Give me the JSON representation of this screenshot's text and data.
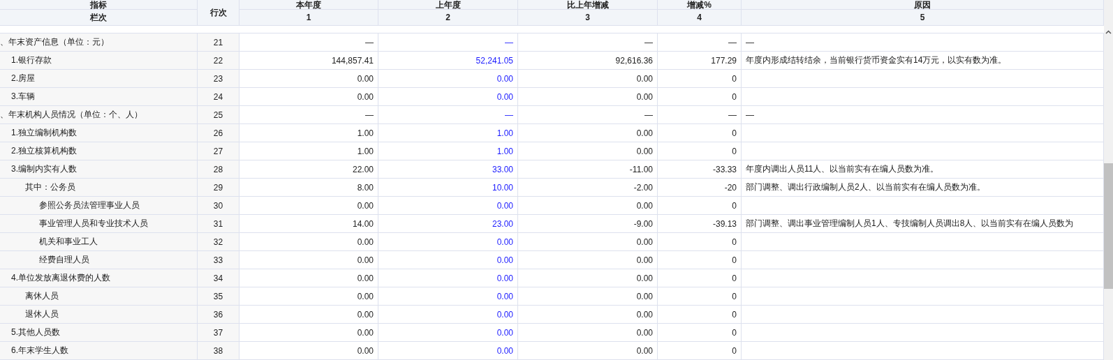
{
  "table": {
    "header_top": [
      "指标",
      "行次",
      "本年度",
      "上年度",
      "比上年增减",
      "增减%",
      "原因"
    ],
    "header_sub": [
      "栏次",
      "1",
      "2",
      "3",
      "4",
      "5"
    ],
    "rows": [
      {
        "label": "、年末资产信息（单位：元）",
        "line": "21",
        "values": [
          "—",
          "—",
          "—",
          "—"
        ],
        "reason": "—",
        "children": [
          {
            "label": "1.银行存款",
            "line": "22",
            "values": [
              "144,857.41",
              "52,241.05",
              "92,616.36",
              "177.29"
            ],
            "reason": "年度内形成结转结余，当前银行货币资金实有14万元，以实有数为准。"
          },
          {
            "label": "2.房屋",
            "line": "23",
            "values": [
              "0.00",
              "0.00",
              "0.00",
              "0"
            ]
          },
          {
            "label": "3.车辆",
            "line": "24",
            "values": [
              "0.00",
              "0.00",
              "0.00",
              "0"
            ]
          }
        ]
      },
      {
        "label": "、年末机构人员情况（单位：个、人）",
        "line": "25",
        "values": [
          "—",
          "—",
          "—",
          "—"
        ],
        "reason": "—",
        "children": [
          {
            "label": "1.独立编制机构数",
            "line": "26",
            "values": [
              "1.00",
              "1.00",
              "0.00",
              "0"
            ]
          },
          {
            "label": "2.独立核算机构数",
            "line": "27",
            "values": [
              "1.00",
              "1.00",
              "0.00",
              "0"
            ]
          },
          {
            "label": "3.编制内实有人数",
            "line": "28",
            "values": [
              "22.00",
              "33.00",
              "-11.00",
              "-33.33"
            ],
            "reason": "年度内调出人员11人、以当前实有在编人员数为准。",
            "children": [
              {
                "label": "其中：公务员",
                "line": "29",
                "values": [
                  "8.00",
                  "10.00",
                  "-2.00",
                  "-20"
                ],
                "reason": "部门调整、调出行政编制人员2人、以当前实有在编人员数为准。",
                "children": [
                  {
                    "label": "参照公务员法管理事业人员",
                    "line": "30",
                    "values": [
                      "0.00",
                      "0.00",
                      "0.00",
                      "0"
                    ]
                  },
                  {
                    "label": "事业管理人员和专业技术人员",
                    "line": "31",
                    "values": [
                      "14.00",
                      "23.00",
                      "-9.00",
                      "-39.13"
                    ],
                    "reason": "部门调整、调出事业管理编制人员1人、专技编制人员调出8人、以当前实有在编人员数为"
                  },
                  {
                    "label": "机关和事业工人",
                    "line": "32",
                    "values": [
                      "0.00",
                      "0.00",
                      "0.00",
                      "0"
                    ]
                  },
                  {
                    "label": "经费自理人员",
                    "line": "33",
                    "values": [
                      "0.00",
                      "0.00",
                      "0.00",
                      "0"
                    ]
                  }
                ]
              }
            ]
          },
          {
            "label": "4.单位发放离退休费的人数",
            "line": "34",
            "values": [
              "0.00",
              "0.00",
              "0.00",
              "0"
            ],
            "children": [
              {
                "label": "离休人员",
                "line": "35",
                "values": [
                  "0.00",
                  "0.00",
                  "0.00",
                  "0"
                ]
              },
              {
                "label": "退休人员",
                "line": "36",
                "values": [
                  "0.00",
                  "0.00",
                  "0.00",
                  "0"
                ]
              }
            ]
          },
          {
            "label": "5.其他人员数",
            "line": "37",
            "values": [
              "0.00",
              "0.00",
              "0.00",
              "0"
            ]
          },
          {
            "label": "6.年末学生人数",
            "line": "38",
            "values": [
              "0.00",
              "0.00",
              "0.00",
              "0"
            ]
          }
        ]
      }
    ]
  }
}
